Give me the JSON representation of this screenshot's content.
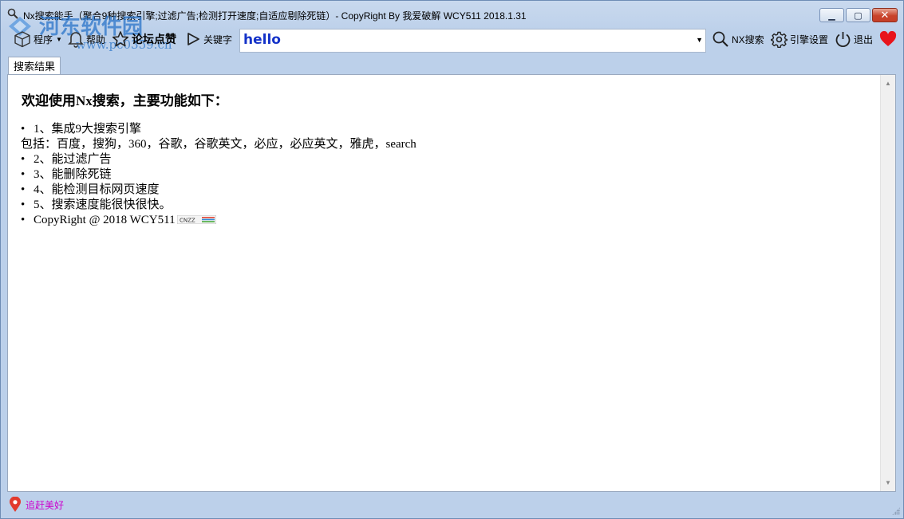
{
  "window": {
    "title": "Nx搜索能手（聚合9种搜索引擎;过滤广告;检测打开速度;自适应剔除死链）- CopyRight By 我爱破解 WCY511 2018.1.31",
    "watermark": "河东软件园",
    "watermark_url": "www.pc0359.cn"
  },
  "toolbar": {
    "program_label": "程序",
    "help_label": "帮助",
    "forum_label": "论坛点赞",
    "keyword_label": "关键字",
    "search_value": "hello",
    "search_button_label": "NX搜索",
    "engine_settings_label": "引擎设置",
    "exit_label": "退出"
  },
  "tabs": [
    {
      "label": "搜索结果"
    }
  ],
  "content": {
    "heading": "欢迎使用Nx搜索，主要功能如下：",
    "items": [
      {
        "text": "1、集成9大搜索引擎"
      },
      {
        "text": "包括：百度，搜狗，360，谷歌，谷歌英文，必应，必应英文，雅虎，search"
      },
      {
        "text": "2、能过滤广告"
      },
      {
        "text": "3、能删除死链"
      },
      {
        "text": "4、能检测目标网页速度"
      },
      {
        "text": "5、搜索速度能很快很快。"
      },
      {
        "text": "CopyRight @ 2018 WCY511"
      }
    ],
    "badge_text": "CNZZ"
  },
  "status": {
    "text": "追赶美好"
  },
  "colors": {
    "accent": "#1432c8",
    "heart": "#e8141c",
    "status_text": "#cc00cc"
  }
}
